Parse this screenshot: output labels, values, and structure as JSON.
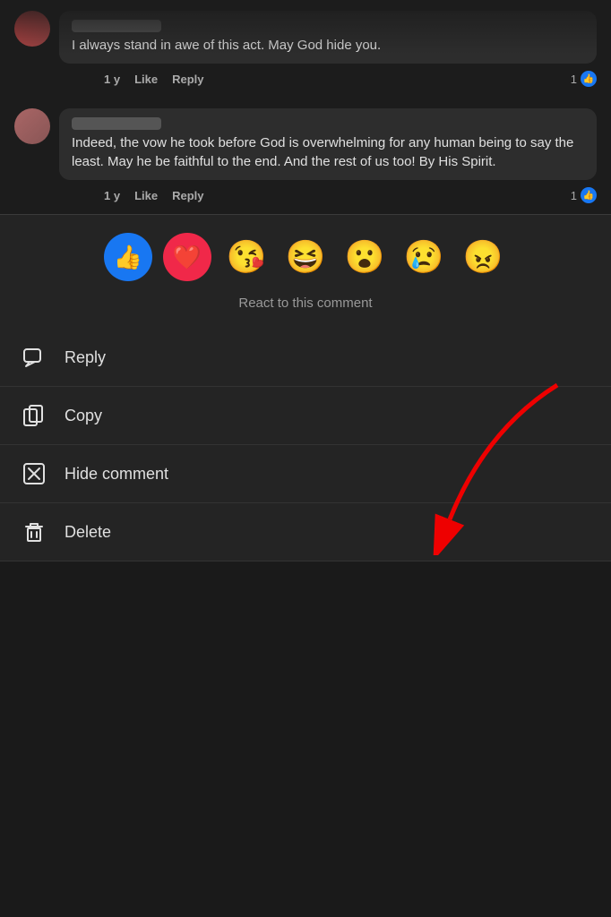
{
  "page": {
    "background": "#1a1a1a"
  },
  "comments": [
    {
      "id": 1,
      "author_visible": false,
      "text": "I always stand in awe of this act. May God hide you.",
      "time": "1 y",
      "like_label": "Like",
      "reply_label": "Reply",
      "reaction_count": "1"
    },
    {
      "id": 2,
      "author_visible": false,
      "text": "Indeed, the vow he took before God is overwhelming for any human being to say the least. May he be faithful to the end. And the rest of us too! By His Spirit.",
      "time": "1 y",
      "like_label": "Like",
      "reply_label": "Reply",
      "reaction_count": "1"
    }
  ],
  "react_label": "React to this comment",
  "emojis": [
    {
      "name": "like",
      "symbol": "👍",
      "type": "like-blue"
    },
    {
      "name": "love",
      "symbol": "❤️",
      "type": "love-red"
    },
    {
      "name": "haha-wink",
      "symbol": "😘"
    },
    {
      "name": "haha",
      "symbol": "😆"
    },
    {
      "name": "wow",
      "symbol": "😮"
    },
    {
      "name": "sad",
      "symbol": "😢"
    },
    {
      "name": "angry",
      "symbol": "😠"
    }
  ],
  "menu_items": [
    {
      "id": "reply",
      "label": "Reply",
      "icon": "reply-icon"
    },
    {
      "id": "copy",
      "label": "Copy",
      "icon": "copy-icon"
    },
    {
      "id": "hide",
      "label": "Hide comment",
      "icon": "hide-icon"
    },
    {
      "id": "delete",
      "label": "Delete",
      "icon": "delete-icon"
    }
  ]
}
